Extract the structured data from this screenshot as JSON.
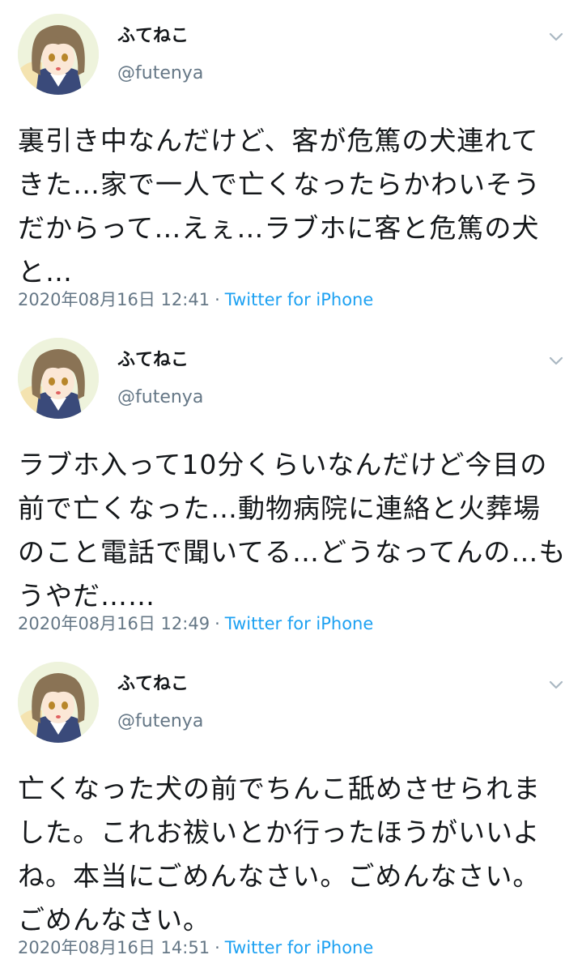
{
  "tweets": [
    {
      "display_name": "ふてねこ",
      "handle": "@futenya",
      "text": "裏引き中なんだけど、客が危篤の犬連れて\nきた…家で一人で亡くなったらかわいそう\nだからって…えぇ…ラブホに客と危篤の犬\nと…",
      "timestamp": "2020年08月16日 12:41",
      "separator": "·",
      "source": "Twitter for iPhone"
    },
    {
      "display_name": "ふてねこ",
      "handle": "@futenya",
      "text": "ラブホ入って10分くらいなんだけど今目の\n前で亡くなった…動物病院に連絡と火葬場\nのこと電話で聞いてる…どうなってんの…も\nうやだ……",
      "timestamp": "2020年08月16日 12:49",
      "separator": "·",
      "source": "Twitter for iPhone"
    },
    {
      "display_name": "ふてねこ",
      "handle": "@futenya",
      "text": "亡くなった犬の前でちんこ舐めさせられま\nした。これお祓いとか行ったほうがいいよ\nね。本当にごめんなさい。ごめんなさい。\nごめんなさい。",
      "timestamp": "2020年08月16日 14:51",
      "separator": "·",
      "source": "Twitter for iPhone"
    }
  ],
  "icons": {
    "caret": "chevron-down-icon",
    "avatar": "anime-girl-avatar"
  },
  "colors": {
    "text": "#14171a",
    "secondary": "#657786",
    "link": "#1da1f2",
    "background": "#ffffff"
  }
}
